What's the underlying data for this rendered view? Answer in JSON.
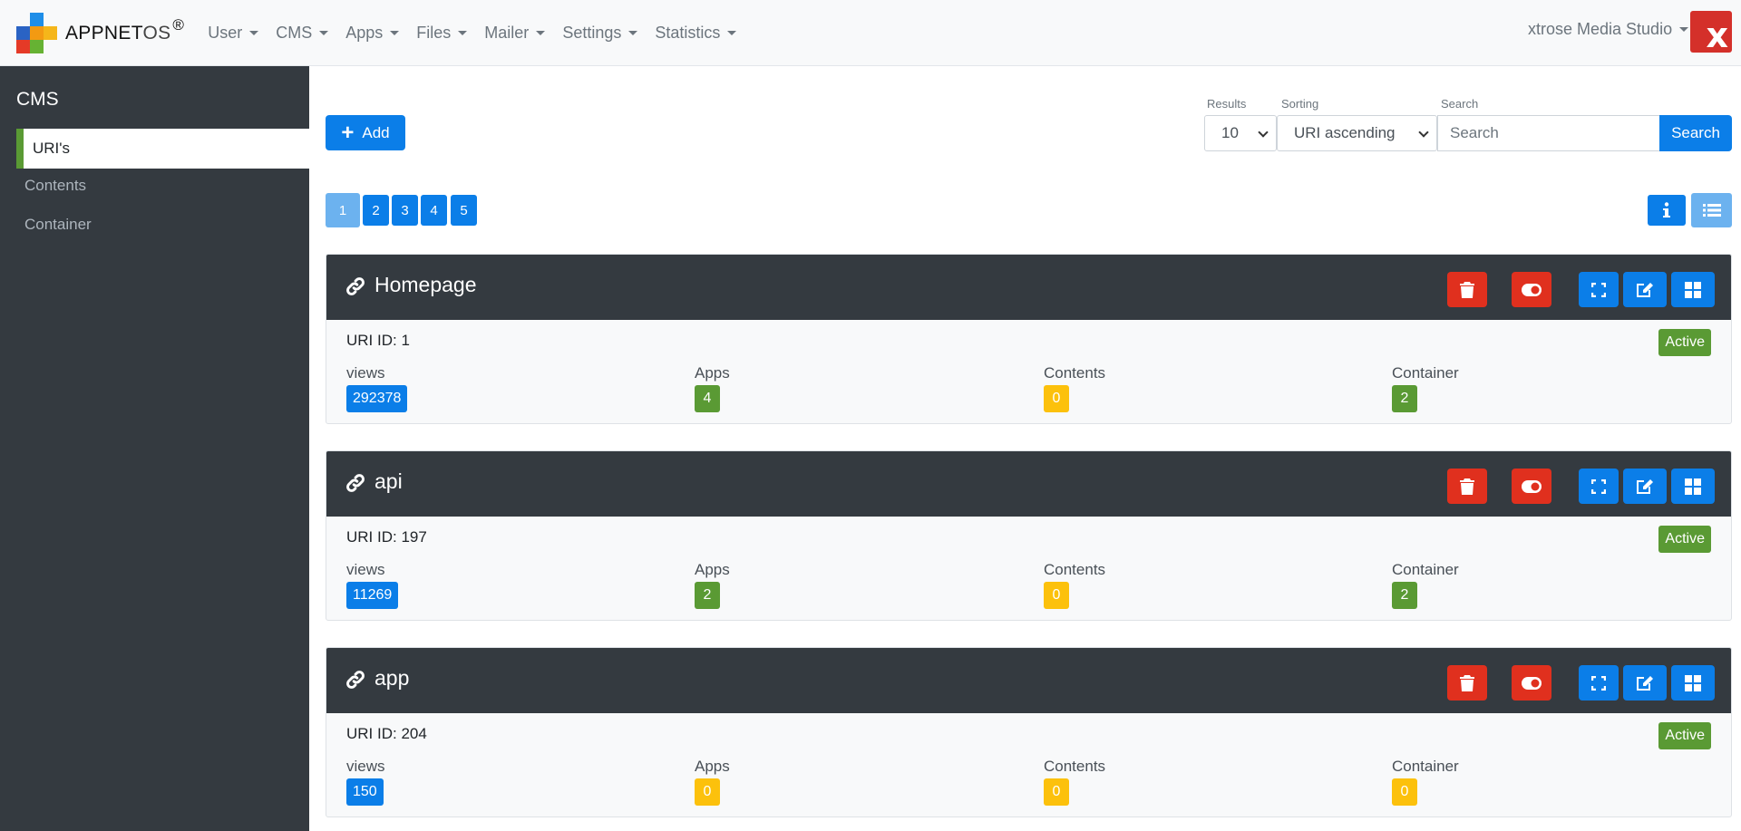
{
  "brand": {
    "name": "APPNET",
    "os": "OS",
    "mark": "®"
  },
  "nav": [
    "User",
    "CMS",
    "Apps",
    "Files",
    "Mailer",
    "Settings",
    "Statistics"
  ],
  "user": {
    "name": "xtrose Media Studio",
    "avatar_letter": "x"
  },
  "sidebar": {
    "title": "CMS",
    "items": [
      {
        "label": "URI's",
        "active": true
      },
      {
        "label": "Contents",
        "active": false
      },
      {
        "label": "Container",
        "active": false
      }
    ]
  },
  "toolbar": {
    "add_label": "Add",
    "results_label": "Results",
    "results_value": "10",
    "sorting_label": "Sorting",
    "sorting_value": "URI ascending",
    "search_label": "Search",
    "search_placeholder": "Search",
    "search_button": "Search"
  },
  "pagination": [
    "1",
    "2",
    "3",
    "4",
    "5"
  ],
  "labels": {
    "uri_id_prefix": "URI ID: ",
    "views": "views",
    "apps": "Apps",
    "contents": "Contents",
    "container": "Container"
  },
  "colors": {
    "blue": "#0b7ee8",
    "green": "#5a9a34",
    "yellow": "#fcc10c",
    "red": "#e0301e",
    "dark": "#343a40"
  },
  "uris": [
    {
      "title": "Homepage",
      "uri_id": "URI ID: 1",
      "status": "Active",
      "views": "292378",
      "apps": "4",
      "contents": "0",
      "container": "2"
    },
    {
      "title": "api",
      "uri_id": "URI ID: 197",
      "status": "Active",
      "views": "11269",
      "apps": "2",
      "contents": "0",
      "container": "2"
    },
    {
      "title": "app",
      "uri_id": "URI ID: 204",
      "status": "Active",
      "views": "150",
      "apps": "0",
      "contents": "0",
      "container": "0"
    }
  ]
}
